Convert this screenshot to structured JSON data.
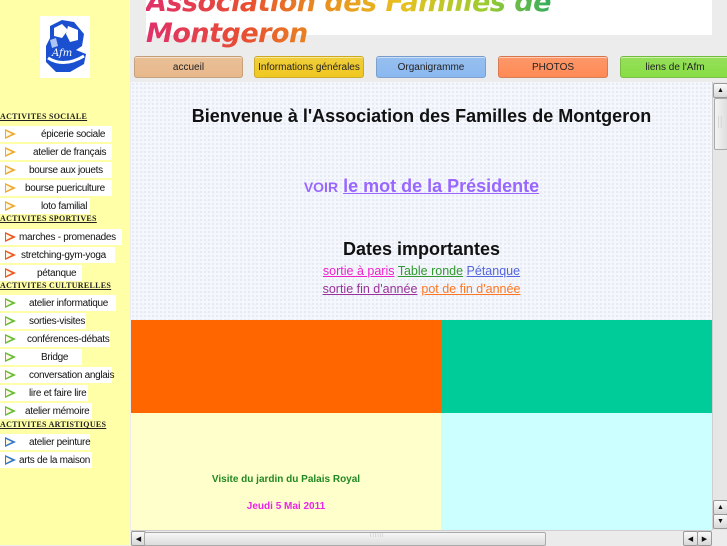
{
  "logo": {
    "alt": "Afm"
  },
  "banner": {
    "title": "Association des Familles de Montgeron"
  },
  "nav": [
    {
      "label": "accueil",
      "color": "#e8b88a"
    },
    {
      "label": "Informations générales",
      "color": "#f0c820"
    },
    {
      "label": "Organigramme",
      "color": "#8ab8f0"
    },
    {
      "label": "PHOTOS",
      "color": "#ff8a55"
    },
    {
      "label": "liens de l'Afm",
      "color": "#88dd44"
    }
  ],
  "sidebar": {
    "sections": [
      {
        "title": "ACTIVITES SOCIALE",
        "icon_color": "orange",
        "items": [
          "épicerie sociale",
          "atelier de français",
          "bourse aux jouets",
          "bourse puericulture",
          "loto familial"
        ]
      },
      {
        "title": "ACTIVITES SPORTIVES",
        "icon_color": "red",
        "items": [
          "marches - promenades",
          "stretching-gym-yoga",
          "pétanque"
        ]
      },
      {
        "title": "ACTIVITES CULTURELLES",
        "icon_color": "green",
        "items": [
          "atelier informatique",
          "sorties-visites",
          "conférences-débats",
          "Bridge",
          "conversation anglais",
          "lire et faire lire",
          "atelier mémoire"
        ]
      },
      {
        "title": "ACTIVITES ARTISTIQUES",
        "icon_color": "blue",
        "items": [
          "atelier peinture",
          "arts de la maison"
        ]
      }
    ]
  },
  "main": {
    "welcome": "Bienvenue à l'Association des Familles de Montgeron",
    "voir_prefix": "VOIR",
    "voir_link": "le mot de la Présidente",
    "dates_title": "Dates importantes",
    "dates_links": [
      {
        "label": "sortie à paris",
        "color": "#ee22cc"
      },
      {
        "label": "Table ronde",
        "color": "#339933"
      },
      {
        "label": "Pétanque",
        "color": "#5566dd"
      },
      {
        "label": "sortie fin d'année",
        "color": "#993399"
      },
      {
        "label": "pot de fin d'année",
        "color": "#ff7722"
      }
    ],
    "event_title": "Visite du jardin du Palais Royal",
    "event_date": "Jeudi 5 Mai 2011"
  },
  "scroll": {
    "up": "▲",
    "down": "▼",
    "left": "◀",
    "right": "▶"
  }
}
